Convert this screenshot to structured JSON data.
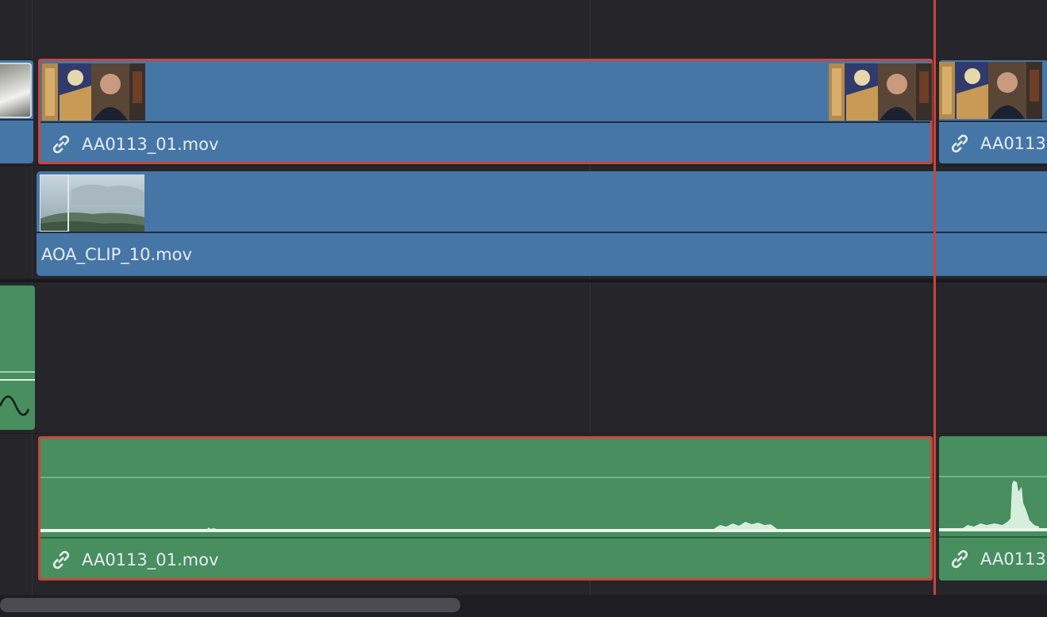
{
  "timeline": {
    "video_track_2": {
      "clip_a": {
        "name": "AA0113_01.mov",
        "linked": true,
        "selected": true
      },
      "clip_b": {
        "name": "AA0113",
        "linked": true,
        "selected": false
      }
    },
    "video_track_1": {
      "clip_a": {
        "name": "AOA_CLIP_10.mov",
        "linked": false,
        "selected": false
      }
    },
    "audio_track_1": {
      "clip_a": {
        "name": "AA0113_01.mov",
        "linked": true,
        "selected": true
      },
      "clip_b": {
        "name": "AA0113",
        "linked": true,
        "selected": false
      }
    },
    "colors": {
      "background": "#25252a",
      "video_clip": "#4676a6",
      "audio_clip": "#488e5e",
      "selection": "#c9453d",
      "playhead": "#c9453d"
    }
  }
}
